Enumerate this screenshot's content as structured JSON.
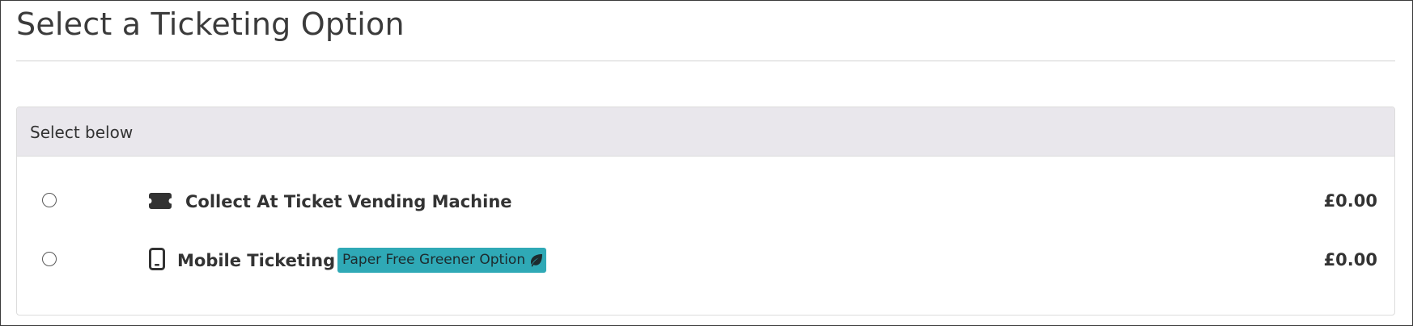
{
  "page": {
    "title": "Select a Ticketing Option"
  },
  "panel": {
    "header": "Select below",
    "options": [
      {
        "icon": "ticket-icon",
        "label": "Collect At Ticket Vending Machine",
        "price": "£0.00",
        "selected": false
      },
      {
        "icon": "mobile-phone-icon",
        "label": "Mobile Ticketing",
        "badge": "Paper Free Greener Option",
        "badge_icon": "leaf-icon",
        "badge_color": "#2fa9b6",
        "price": "£0.00",
        "selected": false
      }
    ]
  },
  "colors": {
    "header_background": "#e9e7ec",
    "text": "#333333",
    "badge_background": "#2fa9b6"
  }
}
